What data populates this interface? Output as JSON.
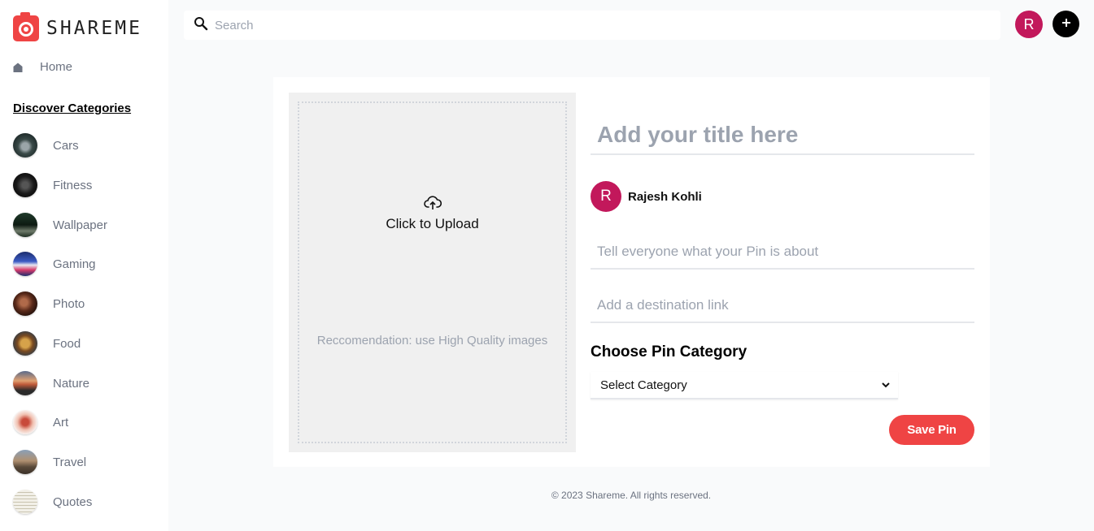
{
  "brand": {
    "name": "SHAREME"
  },
  "sidebar": {
    "home_label": "Home",
    "categories_title": "Discover Categories",
    "categories": [
      {
        "label": "Cars",
        "thumb": "car"
      },
      {
        "label": "Fitness",
        "thumb": "fitness"
      },
      {
        "label": "Wallpaper",
        "thumb": "wallpaper"
      },
      {
        "label": "Gaming",
        "thumb": "gaming"
      },
      {
        "label": "Photo",
        "thumb": "photo"
      },
      {
        "label": "Food",
        "thumb": "food"
      },
      {
        "label": "Nature",
        "thumb": "nature"
      },
      {
        "label": "Art",
        "thumb": "art"
      },
      {
        "label": "Travel",
        "thumb": "travel"
      },
      {
        "label": "Quotes",
        "thumb": "quotes"
      }
    ]
  },
  "header": {
    "search_placeholder": "Search",
    "avatar_initial": "R",
    "add_icon": "plus-icon"
  },
  "form": {
    "upload_label": "Click to Upload",
    "upload_hint": "Reccomendation: use High Quality images",
    "title_placeholder": "Add your title here",
    "user_initial": "R",
    "user_name": "Rajesh Kohli",
    "about_placeholder": "Tell everyone what your Pin is about",
    "destination_placeholder": "Add a destination link",
    "category_heading": "Choose Pin Category",
    "category_selected": "Select Category",
    "save_label": "Save Pin"
  },
  "footer": {
    "text": "© 2023 Shareme. All rights reserved."
  },
  "colors": {
    "accent": "#ef4444",
    "avatar": "#c2185b",
    "muted": "#6b7280",
    "placeholder": "#9ca3af"
  }
}
